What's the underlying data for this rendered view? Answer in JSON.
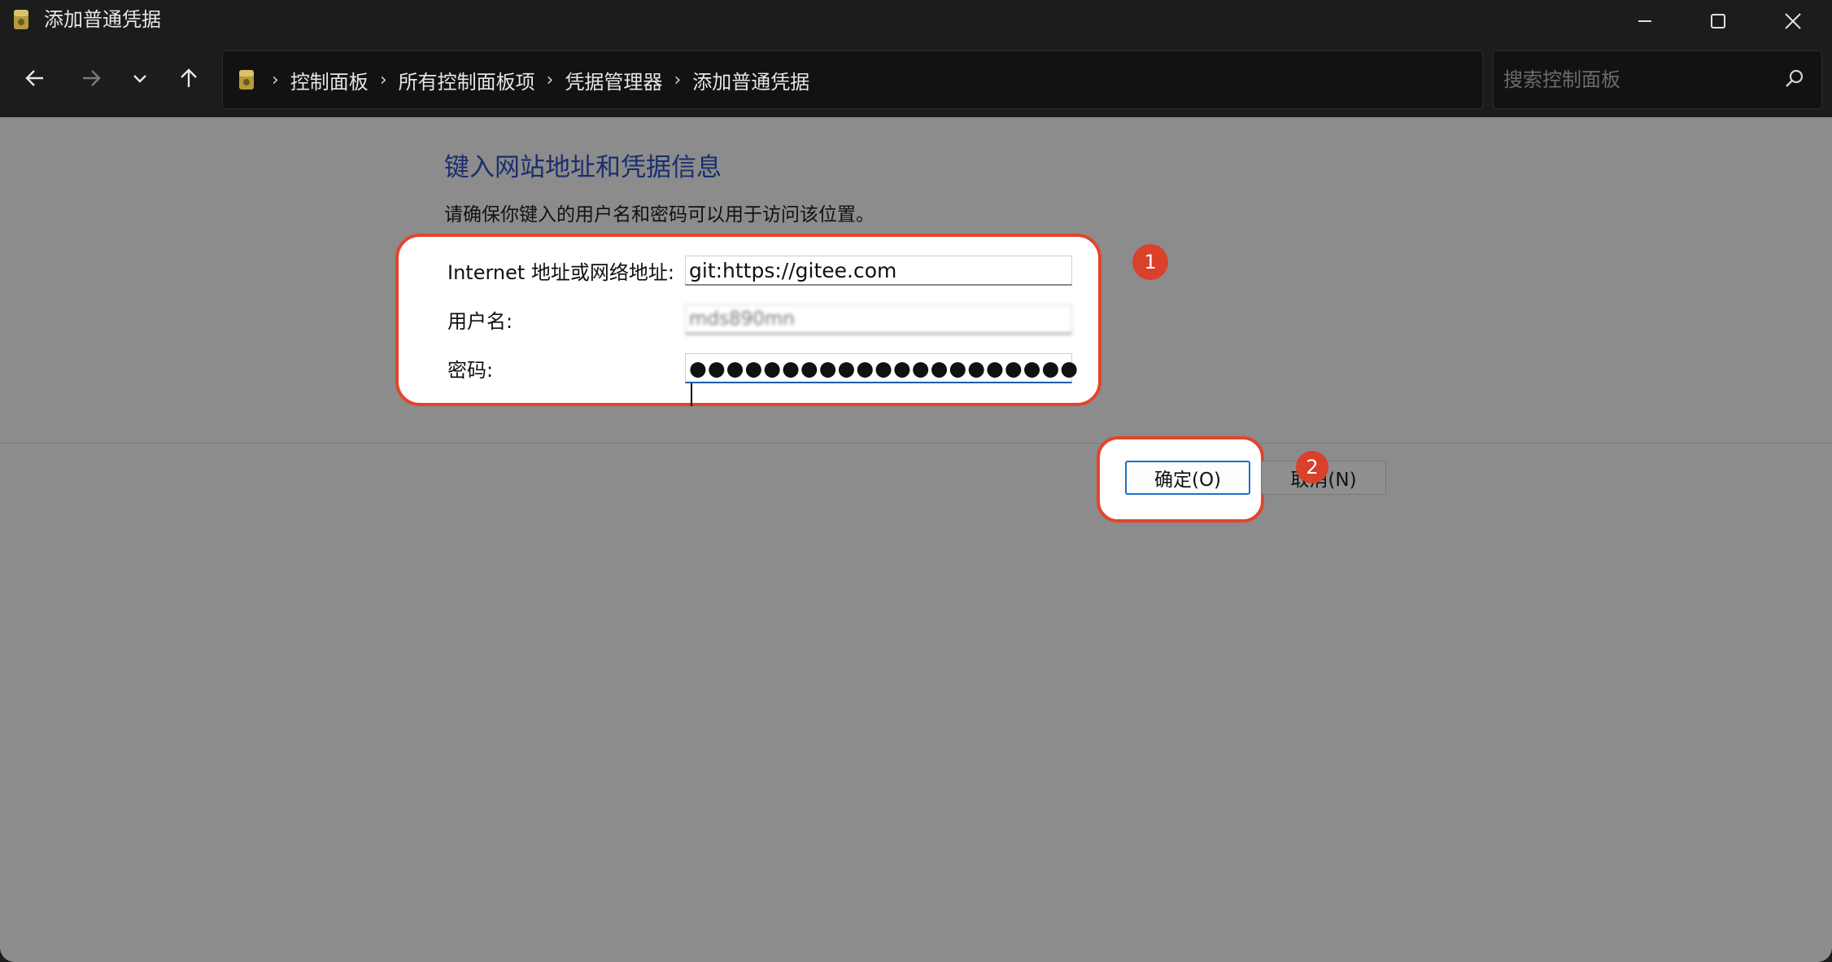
{
  "window": {
    "title": "添加普通凭据"
  },
  "nav": {
    "breadcrumbs": [
      "控制面板",
      "所有控制面板项",
      "凭据管理器",
      "添加普通凭据"
    ],
    "search_placeholder": "搜索控制面板"
  },
  "content": {
    "heading": "键入网站地址和凭据信息",
    "subtext": "请确保你键入的用户名和密码可以用于访问该位置。",
    "fields": {
      "address_label": "Internet 地址或网络地址:",
      "address_value": "git:https://gitee.com",
      "username_label": "用户名:",
      "username_value": "mds890mn",
      "password_label": "密码:",
      "password_value": "●●●●●●●●●●●●●●●●●●●●●"
    },
    "badges": {
      "one": "1",
      "two": "2"
    },
    "buttons": {
      "ok": "确定(O)",
      "cancel": "取消(N)"
    }
  },
  "colors": {
    "highlight": "#e2452c",
    "badge": "#d9412a",
    "heading": "#1a2e6e",
    "background": "#8c8c8c",
    "titlebar": "#1c1c1c"
  }
}
